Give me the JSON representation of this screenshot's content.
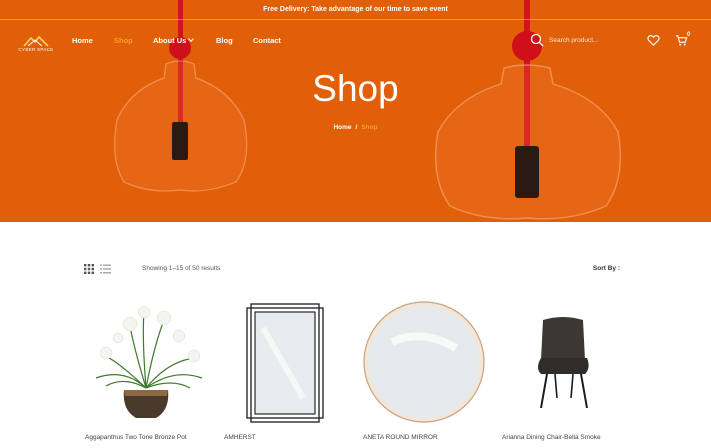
{
  "announcement": "Free Delivery: Take advantage of our time to save event",
  "brand": {
    "logo_text": "CYBER SPACE"
  },
  "nav": {
    "items": [
      {
        "label": "Home",
        "active": false
      },
      {
        "label": "Shop",
        "active": true
      },
      {
        "label": "About Us",
        "active": false,
        "has_dropdown": true
      },
      {
        "label": "Blog",
        "active": false
      },
      {
        "label": "Contact",
        "active": false
      }
    ]
  },
  "header": {
    "search_placeholder": "Search product...",
    "cart_count": "0"
  },
  "hero": {
    "title": "Shop",
    "breadcrumb": {
      "home": "Home",
      "separator": "/",
      "current": "Shop"
    }
  },
  "toolbar": {
    "result_text": "Showing 1–15 of 50 results",
    "sort_label": "Sort By :"
  },
  "products": [
    {
      "name": "Aggapanthus Two Tone Bronze Pot"
    },
    {
      "name": "AMHERST"
    },
    {
      "name": "ANETA ROUND MIRROR"
    },
    {
      "name": "Arianna Dining Chair-Bella Smoke"
    }
  ],
  "colors": {
    "hero_bg": "#e25f09",
    "accent": "#f4a21e"
  }
}
